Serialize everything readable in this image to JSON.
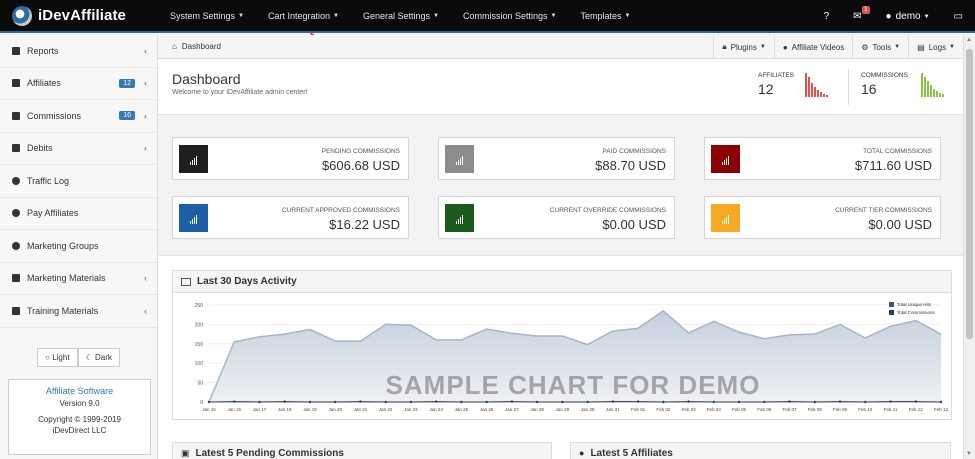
{
  "app": {
    "brand": "iDevAffiliate",
    "menu": [
      {
        "label": "System Settings"
      },
      {
        "label": "Cart Integration"
      },
      {
        "label": "General Settings"
      },
      {
        "label": "Commission Settings"
      },
      {
        "label": "Templates"
      }
    ],
    "nav_right": {
      "help_icon": "question-icon",
      "mail_icon": "envelope-icon",
      "mail_badge": "1",
      "user_label": "demo",
      "user_icon": "user-icon",
      "monitor_icon": "monitor-icon"
    }
  },
  "sidebar": {
    "items": [
      {
        "label": "Reports",
        "icon": "plus-square-icon",
        "badge": "",
        "chevron": true
      },
      {
        "label": "Affiliates",
        "icon": "plus-square-icon",
        "badge": "12",
        "chevron": true
      },
      {
        "label": "Commissions",
        "icon": "plus-square-icon",
        "badge": "16",
        "chevron": true
      },
      {
        "label": "Debits",
        "icon": "plus-square-icon",
        "badge": "",
        "chevron": true
      },
      {
        "label": "Traffic Log",
        "icon": "arrow-circle-icon",
        "badge": "",
        "chevron": false
      },
      {
        "label": "Pay Affiliates",
        "icon": "arrow-circle-icon",
        "badge": "",
        "chevron": false
      },
      {
        "label": "Marketing Groups",
        "icon": "arrow-circle-icon",
        "badge": "",
        "chevron": false
      },
      {
        "label": "Marketing Materials",
        "icon": "plus-square-icon",
        "badge": "",
        "chevron": true
      },
      {
        "label": "Training Materials",
        "icon": "plus-square-icon",
        "badge": "",
        "chevron": true
      }
    ],
    "theme": {
      "light": "Light",
      "dark": "Dark"
    },
    "software": {
      "title": "Affiliate Software",
      "version": "Version 9.0",
      "copyright": "Copyright © 1999-2019",
      "company": "iDevDirect LLC"
    }
  },
  "breadcrumb": {
    "home": "Dashboard"
  },
  "toolbar": {
    "plugins": "Plugins",
    "videos": "Affiliate Videos",
    "tools": "Tools",
    "logs": "Logs"
  },
  "dashboard": {
    "title": "Dashboard",
    "subtitle": "Welcome to your iDevAffiliate admin center!",
    "affiliates_label": "AFFILIATES",
    "affiliates_value": "12",
    "commissions_label": "COMMISSIONS",
    "commissions_value": "16",
    "affiliates_color": "#d9534f",
    "commissions_color": "#8bc34a"
  },
  "cards": [
    {
      "label": "PENDING COMMISSIONS",
      "value": "$606.68 USD",
      "color": "#1f1f1f"
    },
    {
      "label": "PAID COMMISSIONS",
      "value": "$88.70 USD",
      "color": "#8c8c8c"
    },
    {
      "label": "TOTAL COMMISSIONS",
      "value": "$711.60 USD",
      "color": "#8b0000"
    },
    {
      "label": "CURRENT APPROVED COMMISSIONS",
      "value": "$16.22 USD",
      "color": "#1f5fa8"
    },
    {
      "label": "CURRENT OVERRIDE COMMISSIONS",
      "value": "$0.00 USD",
      "color": "#1d5a1d"
    },
    {
      "label": "CURRENT TIER COMMISSIONS",
      "value": "$0.00 USD",
      "color": "#f7a823"
    }
  ],
  "activity": {
    "title": "Last 30 Days Activity",
    "watermark": "SAMPLE CHART FOR DEMO"
  },
  "chart_data": {
    "type": "area",
    "x": [
      "Jan 15",
      "Jan 16",
      "Jan 17",
      "Jan 18",
      "Jan 19",
      "Jan 20",
      "Jan 21",
      "Jan 22",
      "Jan 23",
      "Jan 24",
      "Jan 25",
      "Jan 26",
      "Jan 27",
      "Jan 28",
      "Jan 29",
      "Jan 30",
      "Jan 31",
      "Feb 01",
      "Feb 02",
      "Feb 03",
      "Feb 04",
      "Feb 05",
      "Feb 06",
      "Feb 07",
      "Feb 08",
      "Feb 09",
      "Feb 10",
      "Feb 11",
      "Feb 12",
      "Feb 13"
    ],
    "series": [
      {
        "name": "Total Unique Hits",
        "color": "#a8b4c4",
        "values": [
          0,
          155,
          168,
          175,
          187,
          157,
          157,
          200,
          198,
          160,
          160,
          188,
          177,
          170,
          170,
          148,
          183,
          190,
          235,
          178,
          208,
          180,
          163,
          173,
          175,
          200,
          165,
          195,
          210,
          175
        ]
      },
      {
        "name": "Total Commissions",
        "color": "#2c3e50",
        "values": [
          0,
          1,
          0,
          1,
          0,
          0,
          1,
          0,
          0,
          1,
          0,
          0,
          1,
          0,
          0,
          0,
          1,
          1,
          0,
          1,
          0,
          0,
          0,
          1,
          0,
          1,
          0,
          1,
          1,
          0
        ]
      }
    ],
    "ylim": [
      0,
      250
    ],
    "yticks": [
      0,
      50,
      100,
      150,
      200,
      250
    ],
    "legend": "top-right"
  },
  "bottom_panels": {
    "pending": "Latest 5 Pending Commissions",
    "affiliates": "Latest 5 Affiliates"
  }
}
